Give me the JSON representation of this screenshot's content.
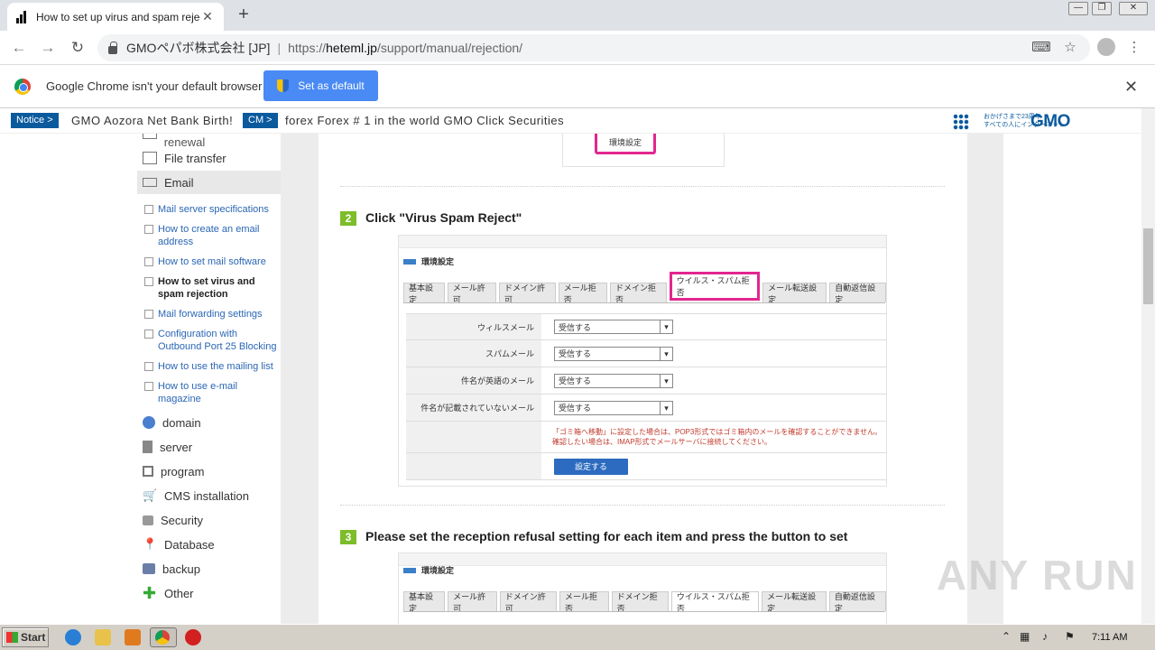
{
  "browser": {
    "tab_title": "How to set up virus and spam reject",
    "org": "GMOペパボ株式会社 [JP]",
    "url_scheme": "https://",
    "url_host": "heteml.jp",
    "url_path": "/support/manual/rejection/",
    "infobar_text": "Google Chrome isn't your default browser",
    "set_default_label": "Set as default"
  },
  "notice": {
    "tag1": "Notice >",
    "text1": "GMO Aozora Net Bank Birth!",
    "tag2": "CM >",
    "text2": "forex Forex # 1 in the world GMO Click Securities",
    "gmo_small_line1": "おかげさまで23周年",
    "gmo_small_line2": "すべての人にインターネット",
    "gmo_logo": "GMO"
  },
  "sidebar": {
    "top_partial": "New contract / renewal",
    "items": [
      {
        "label": "File transfer",
        "icon": "file-transfer-icon"
      },
      {
        "label": "Email",
        "icon": "email-icon"
      }
    ],
    "subitems": [
      "Mail server specifications",
      "How to create an email address",
      "How to set mail software",
      "How to set virus and spam rejection",
      "Mail forwarding settings",
      "Configuration with Outbound Port 25 Blocking",
      "How to use the mailing list",
      "How to use e-mail magazine"
    ],
    "items2": [
      {
        "label": "domain",
        "icon": "globe-icon"
      },
      {
        "label": "server",
        "icon": "server-icon"
      },
      {
        "label": "program",
        "icon": "program-icon"
      },
      {
        "label": "CMS installation",
        "icon": "cart-icon"
      },
      {
        "label": "Security",
        "icon": "lock-icon"
      },
      {
        "label": "Database",
        "icon": "pin-icon"
      },
      {
        "label": "backup",
        "icon": "backup-icon"
      },
      {
        "label": "Other",
        "icon": "plus-icon"
      }
    ]
  },
  "content": {
    "top_button": "環境設定",
    "step2_num": "2",
    "step2_text": "Click \"Virus Spam Reject\"",
    "step3_num": "3",
    "step3_text": "Please set the reception refusal setting for each item and press the button to set",
    "shot_title": "環境設定",
    "tabs": [
      "基本設定",
      "メール許可",
      "ドメイン許可",
      "メール拒否",
      "ドメイン拒否",
      "ウイルス・スパム拒否",
      "メール転送設定",
      "自動返信設定"
    ],
    "rows": [
      {
        "label": "ウィルスメール",
        "value": "受信する"
      },
      {
        "label": "スパムメール",
        "value": "受信する"
      },
      {
        "label": "件名が英語のメール",
        "value": "受信する"
      },
      {
        "label": "件名が記載されていないメール",
        "value": "受信する"
      }
    ],
    "warn_line1": "「ゴミ箱へ移動」に設定した場合は、POP3形式ではゴミ箱内のメールを確認することができません。",
    "warn_line2": "確認したい場合は、IMAP形式でメールサーバに接続してください。",
    "submit": "設定する"
  },
  "watermark": "ANY RUN",
  "taskbar": {
    "start": "Start",
    "clock": "7:11 AM"
  }
}
